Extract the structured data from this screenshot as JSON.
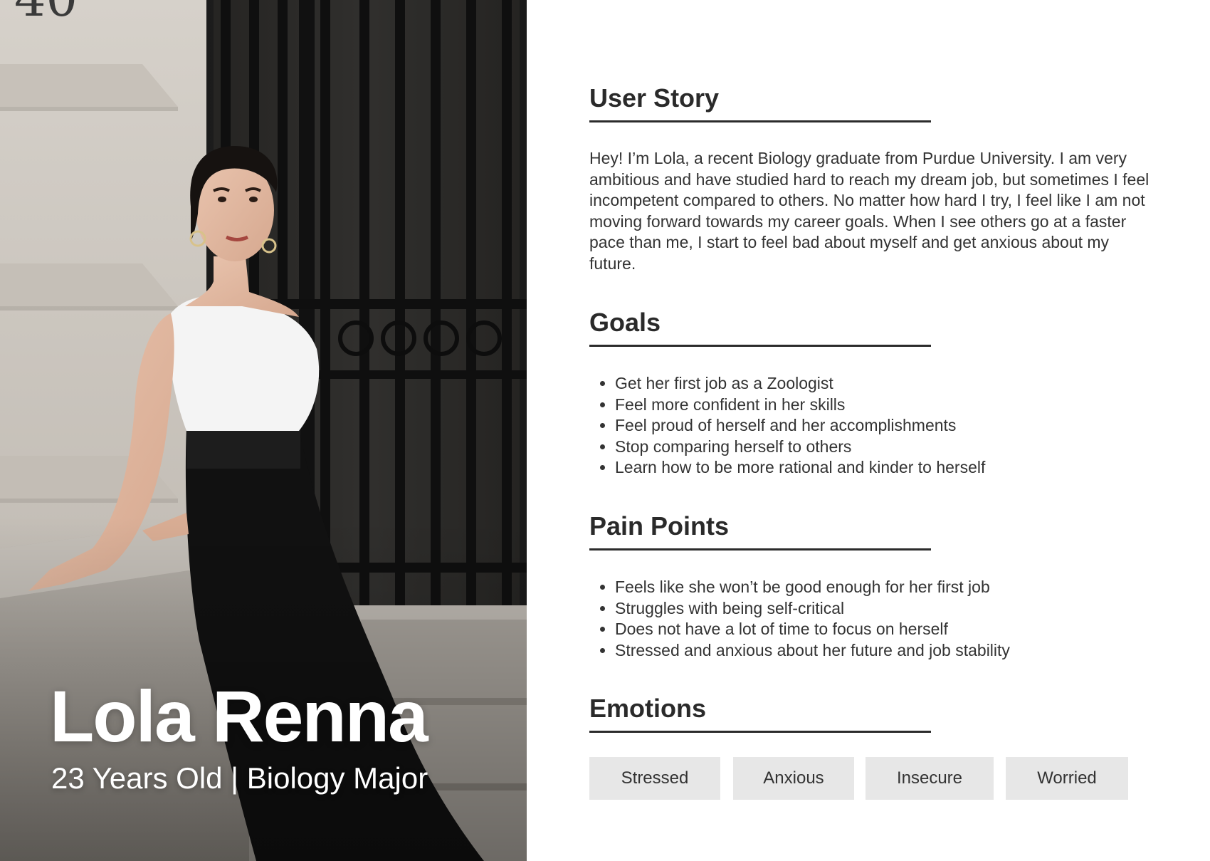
{
  "persona": {
    "name": "Lola Renna",
    "meta": "23 Years Old | Biology Major"
  },
  "user_story": {
    "title": "User Story",
    "text": "Hey! I’m Lola, a recent Biology graduate from Purdue University. I am very ambitious and have studied hard to reach my dream job, but sometimes I feel incompetent compared to others. No matter how hard I try, I feel like I am not moving forward towards my career goals. When I see others go at a faster pace than me, I start to feel bad about myself and get anxious about my future."
  },
  "goals": {
    "title": "Goals",
    "items": [
      "Get her first job as a Zoologist",
      "Feel more confident in her skills",
      "Feel proud of herself and her accomplishments",
      "Stop comparing herself to others",
      "Learn how to be more rational and kinder to herself"
    ]
  },
  "pain_points": {
    "title": "Pain Points",
    "items": [
      "Feels like she won’t be good enough for her first job",
      "Struggles with being self-critical",
      "Does not have a lot of time to focus on herself",
      "Stressed and anxious about her future and job stability"
    ]
  },
  "emotions": {
    "title": "Emotions",
    "items": [
      "Stressed",
      "Anxious",
      "Insecure",
      "Worried"
    ]
  },
  "colors": {
    "heading": "#2a2a2a",
    "rule": "#2b2b2b",
    "chip_bg": "#e7e7e7",
    "name_text": "#ffffff"
  }
}
